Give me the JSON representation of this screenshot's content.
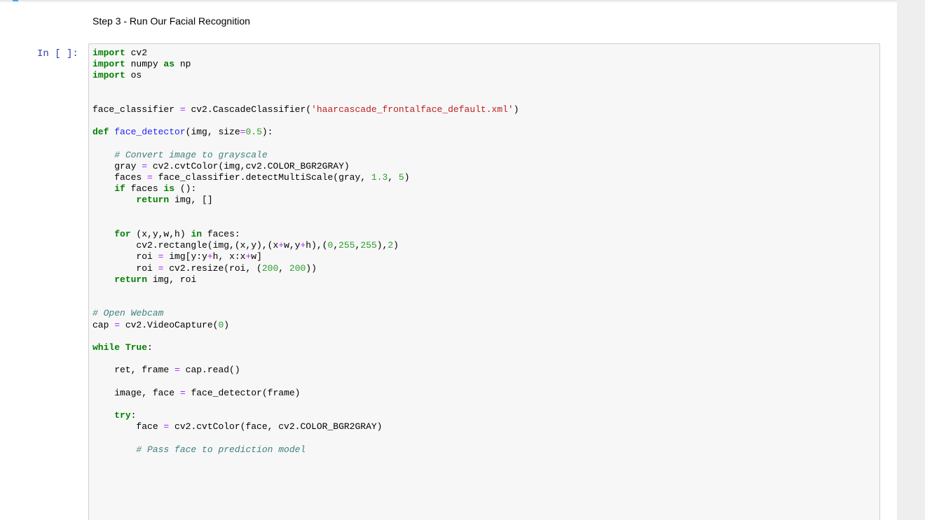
{
  "notebook": {
    "markdown_cell": {
      "text": "Step 3 - Run Our Facial Recognition"
    },
    "code_cell": {
      "prompt": "In [ ]:",
      "lines": [
        [
          [
            "kw",
            "import"
          ],
          [
            "plain",
            " cv2"
          ]
        ],
        [
          [
            "kw",
            "import"
          ],
          [
            "plain",
            " numpy "
          ],
          [
            "kw",
            "as"
          ],
          [
            "plain",
            " np"
          ]
        ],
        [
          [
            "kw",
            "import"
          ],
          [
            "plain",
            " os"
          ]
        ],
        [],
        [],
        [
          [
            "plain",
            "face_classifier "
          ],
          [
            "op",
            "="
          ],
          [
            "plain",
            " cv2.CascadeClassifier("
          ],
          [
            "str",
            "'haarcascade_frontalface_default.xml'"
          ],
          [
            "plain",
            ")"
          ]
        ],
        [],
        [
          [
            "kw",
            "def"
          ],
          [
            "plain",
            " "
          ],
          [
            "def",
            "face_detector"
          ],
          [
            "plain",
            "(img, size"
          ],
          [
            "op",
            "="
          ],
          [
            "num",
            "0.5"
          ],
          [
            "plain",
            "):"
          ]
        ],
        [],
        [
          [
            "plain",
            "    "
          ],
          [
            "com",
            "# Convert image to grayscale"
          ]
        ],
        [
          [
            "plain",
            "    gray "
          ],
          [
            "op",
            "="
          ],
          [
            "plain",
            " cv2.cvtColor(img,cv2.COLOR_BGR2GRAY)"
          ]
        ],
        [
          [
            "plain",
            "    faces "
          ],
          [
            "op",
            "="
          ],
          [
            "plain",
            " face_classifier.detectMultiScale(gray, "
          ],
          [
            "num",
            "1.3"
          ],
          [
            "plain",
            ", "
          ],
          [
            "num",
            "5"
          ],
          [
            "plain",
            ")"
          ]
        ],
        [
          [
            "plain",
            "    "
          ],
          [
            "kw",
            "if"
          ],
          [
            "plain",
            " faces "
          ],
          [
            "kw",
            "is"
          ],
          [
            "plain",
            " ():"
          ]
        ],
        [
          [
            "plain",
            "        "
          ],
          [
            "kw",
            "return"
          ],
          [
            "plain",
            " img, []"
          ]
        ],
        [],
        [],
        [
          [
            "plain",
            "    "
          ],
          [
            "kw",
            "for"
          ],
          [
            "plain",
            " (x,y,w,h) "
          ],
          [
            "kw",
            "in"
          ],
          [
            "plain",
            " faces:"
          ]
        ],
        [
          [
            "plain",
            "        cv2.rectangle(img,(x,y),(x"
          ],
          [
            "op",
            "+"
          ],
          [
            "plain",
            "w,y"
          ],
          [
            "op",
            "+"
          ],
          [
            "plain",
            "h),("
          ],
          [
            "num",
            "0"
          ],
          [
            "plain",
            ","
          ],
          [
            "num",
            "255"
          ],
          [
            "plain",
            ","
          ],
          [
            "num",
            "255"
          ],
          [
            "plain",
            "),"
          ],
          [
            "num",
            "2"
          ],
          [
            "plain",
            ")"
          ]
        ],
        [
          [
            "plain",
            "        roi "
          ],
          [
            "op",
            "="
          ],
          [
            "plain",
            " img[y:y"
          ],
          [
            "op",
            "+"
          ],
          [
            "plain",
            "h, x:x"
          ],
          [
            "op",
            "+"
          ],
          [
            "plain",
            "w]"
          ]
        ],
        [
          [
            "plain",
            "        roi "
          ],
          [
            "op",
            "="
          ],
          [
            "plain",
            " cv2.resize(roi, ("
          ],
          [
            "num",
            "200"
          ],
          [
            "plain",
            ", "
          ],
          [
            "num",
            "200"
          ],
          [
            "plain",
            "))"
          ]
        ],
        [
          [
            "plain",
            "    "
          ],
          [
            "kw",
            "return"
          ],
          [
            "plain",
            " img, roi"
          ]
        ],
        [],
        [],
        [
          [
            "com",
            "# Open Webcam"
          ]
        ],
        [
          [
            "plain",
            "cap "
          ],
          [
            "op",
            "="
          ],
          [
            "plain",
            " cv2.VideoCapture("
          ],
          [
            "num",
            "0"
          ],
          [
            "plain",
            ")"
          ]
        ],
        [],
        [
          [
            "kw",
            "while"
          ],
          [
            "plain",
            " "
          ],
          [
            "kw",
            "True"
          ],
          [
            "plain",
            ":"
          ]
        ],
        [],
        [
          [
            "plain",
            "    ret, frame "
          ],
          [
            "op",
            "="
          ],
          [
            "plain",
            " cap.read()"
          ]
        ],
        [],
        [
          [
            "plain",
            "    image, face "
          ],
          [
            "op",
            "="
          ],
          [
            "plain",
            " face_detector(frame)"
          ]
        ],
        [],
        [
          [
            "plain",
            "    "
          ],
          [
            "kw",
            "try"
          ],
          [
            "plain",
            ":"
          ]
        ],
        [
          [
            "plain",
            "        face "
          ],
          [
            "op",
            "="
          ],
          [
            "plain",
            " cv2.cvtColor(face, cv2.COLOR_BGR2GRAY)"
          ]
        ],
        [],
        [
          [
            "plain",
            "        "
          ],
          [
            "com",
            "# Pass face to prediction model"
          ]
        ]
      ]
    }
  },
  "colors": {
    "keyword": "#008000",
    "function_name": "#2121ff",
    "string": "#ba2121",
    "number": "#2a9d2a",
    "operator": "#aa22ff",
    "comment": "#408080",
    "prompt": "#303f9f"
  }
}
